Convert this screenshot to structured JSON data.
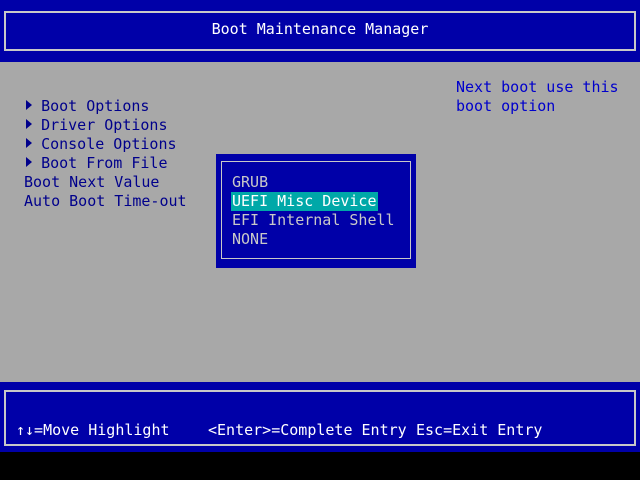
{
  "header": {
    "title": "Boot Maintenance Manager"
  },
  "menu": {
    "items": [
      {
        "label": "Boot Options"
      },
      {
        "label": "Driver Options"
      },
      {
        "label": "Console Options"
      },
      {
        "label": "Boot From File"
      }
    ]
  },
  "fields": {
    "boot_next_label": "Boot Next Value",
    "auto_boot_label": "Auto Boot Time-out"
  },
  "help": {
    "line1": "Next boot use this",
    "line2": "boot option"
  },
  "popup": {
    "options": [
      "GRUB",
      "UEFI Misc Device",
      "EFI Internal Shell",
      "NONE"
    ],
    "selected": "UEFI Misc Device"
  },
  "footer": {
    "move": "↑↓=Move Highlight",
    "enter": "<Enter>=Complete Entry",
    "esc": "Esc=Exit Entry"
  },
  "colors": {
    "header_bg": "#0000a8",
    "body_bg": "#a8a8a8",
    "highlight": "#00a8a8",
    "text_dark": "#00008b"
  }
}
